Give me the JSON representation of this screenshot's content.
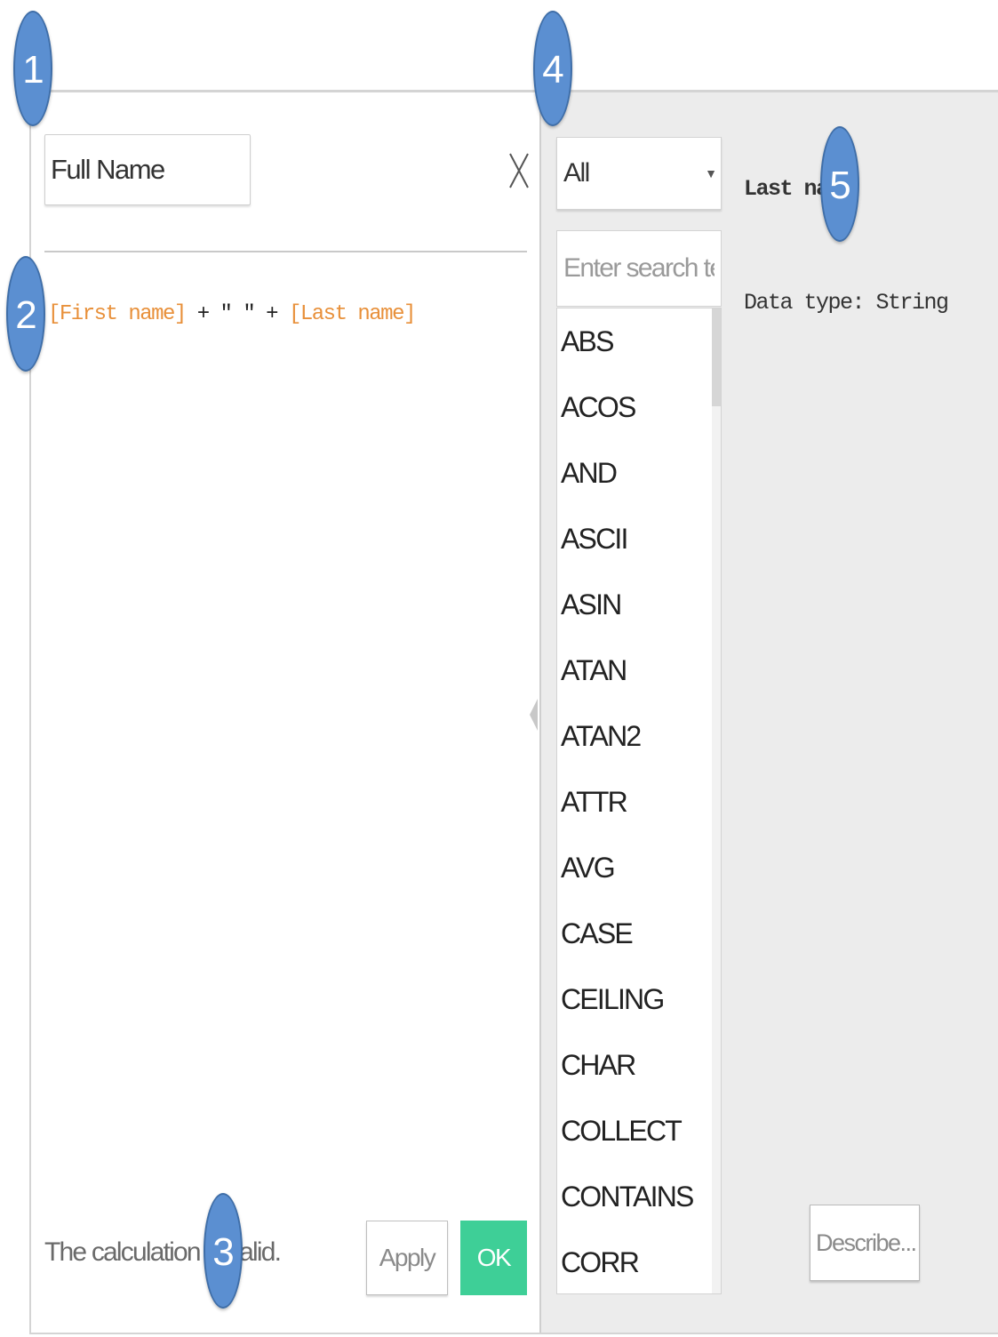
{
  "calc_editor": {
    "name_value": "Full Name",
    "close_label": "X",
    "formula": {
      "field_1": "[First name]",
      "op_1": " + \" \" + ",
      "field_2": "[Last name]"
    },
    "status_text": "The calculation is valid.",
    "apply_label": "Apply",
    "ok_label": "OK"
  },
  "functions_panel": {
    "category_selected": "All",
    "search_placeholder": "Enter search text",
    "functions": [
      "ABS",
      "ACOS",
      "AND",
      "ASCII",
      "ASIN",
      "ATAN",
      "ATAN2",
      "ATTR",
      "AVG",
      "CASE",
      "CEILING",
      "CHAR",
      "COLLECT",
      "CONTAINS",
      "CORR"
    ]
  },
  "detail_panel": {
    "title": "Last name",
    "data_type": "Data type: String",
    "describe_label": "Describe..."
  },
  "callouts": [
    "1",
    "2",
    "3",
    "4",
    "5"
  ],
  "colors": {
    "field_reference": "#e8903a",
    "ok_button": "#3ecf97",
    "callout_badge": "#5b8fd1",
    "right_pane_bg": "#ececec"
  }
}
